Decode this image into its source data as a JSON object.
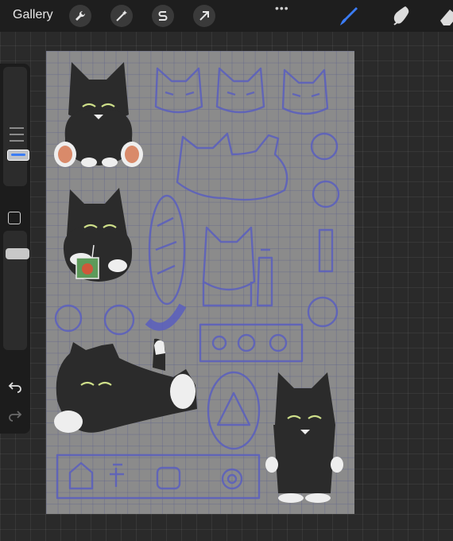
{
  "topbar": {
    "gallery_label": "Gallery",
    "actions": [
      {
        "name": "actions-icon"
      },
      {
        "name": "adjustments-icon"
      },
      {
        "name": "selection-icon"
      },
      {
        "name": "transform-icon"
      }
    ],
    "more_label": "•••",
    "tools": [
      {
        "name": "brush-icon",
        "active": true
      },
      {
        "name": "smudge-icon",
        "active": false
      },
      {
        "name": "eraser-icon",
        "active": false
      }
    ]
  },
  "sidebar": {
    "brush_size_level": 0.6,
    "opacity_level": 0.8,
    "buttons": [
      "modify-square-icon",
      "undo-icon",
      "redo-icon"
    ]
  },
  "canvas": {
    "background_color": "#8b8b8b",
    "sketch_color": "#5a5fbf",
    "ink_color": "#2b2b2b",
    "accent_color": "#d98a6a"
  },
  "colors": {
    "accent_blue": "#3b7cf5",
    "topbar": "#1e1e1e",
    "workspace": "#2a2a2a"
  }
}
